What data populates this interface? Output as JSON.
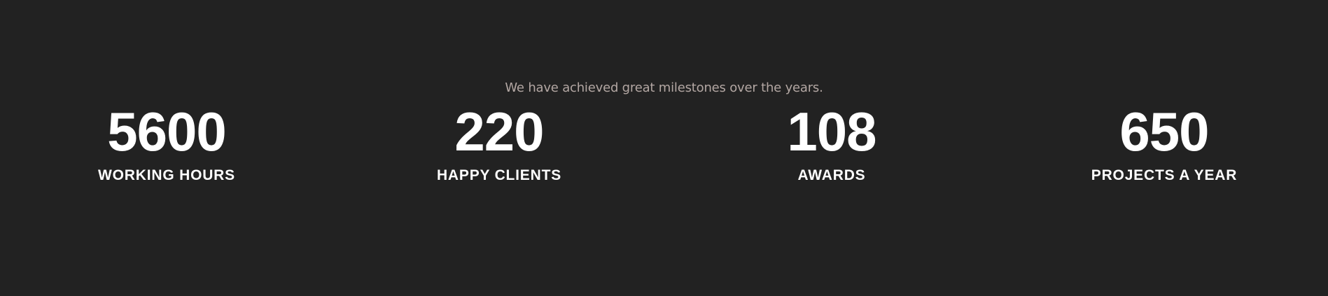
{
  "milestones": {
    "tagline": "We have achieved great milestones over the years.",
    "stats": [
      {
        "value": "5600",
        "label": "WORKING HOURS"
      },
      {
        "value": "220",
        "label": "HAPPY CLIENTS"
      },
      {
        "value": "108",
        "label": "AWARDS"
      },
      {
        "value": "650",
        "label": "PROJECTS A YEAR"
      }
    ]
  },
  "colors": {
    "background": "#222222",
    "tagline": "#b3a7a3",
    "text": "#ffffff"
  }
}
